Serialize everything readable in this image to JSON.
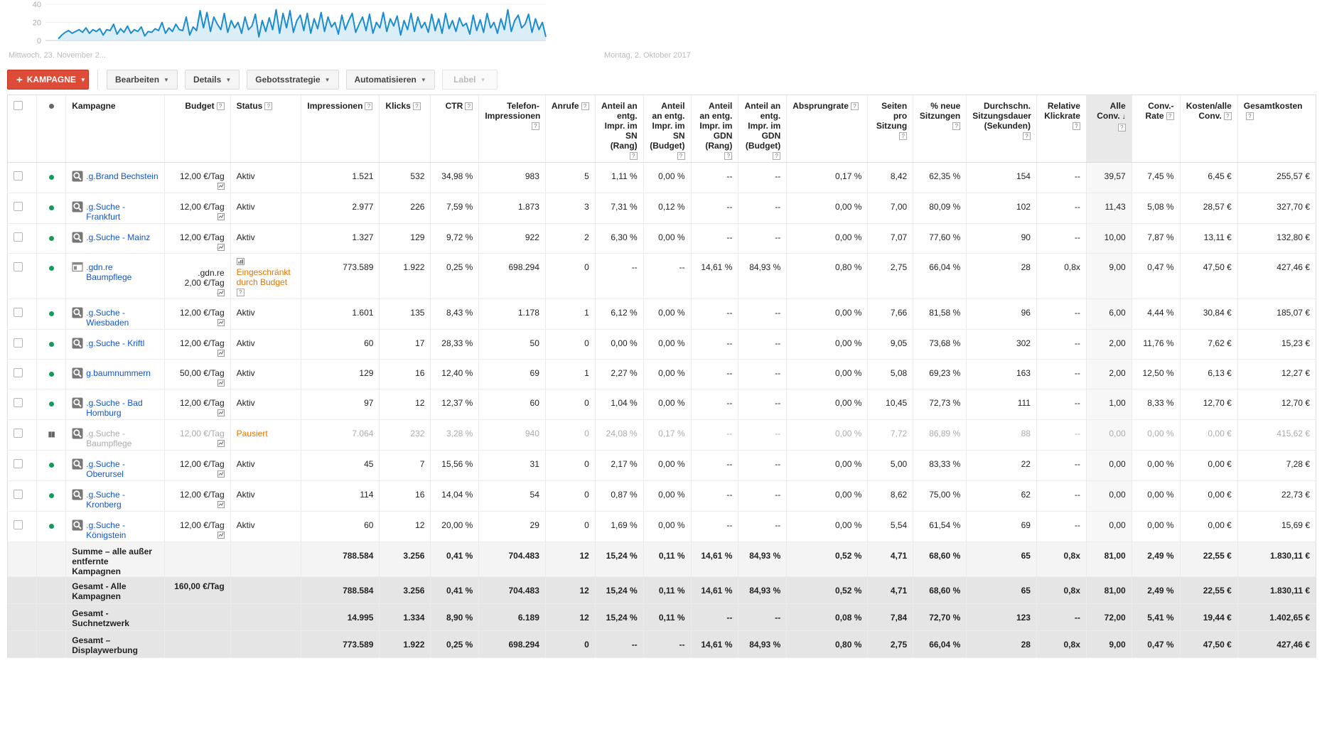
{
  "chart": {
    "y_ticks": [
      "40",
      "20",
      "0"
    ],
    "date_start": "Mittwoch, 23. November 2...",
    "date_end": "Montag, 2. Oktober 2017",
    "line_color": "#1a8ccf",
    "fill_color": "#cce7f5"
  },
  "chart_data": {
    "type": "area",
    "ylim": [
      0,
      40
    ],
    "xlabel": "",
    "ylabel": "",
    "title": "",
    "series": [
      {
        "values": [
          2,
          6,
          9,
          11,
          8,
          10,
          12,
          9,
          14,
          8,
          12,
          10,
          13,
          6,
          12,
          11,
          18,
          7,
          13,
          9,
          16,
          8,
          12,
          10,
          15,
          5,
          10,
          9,
          13,
          11,
          20,
          8,
          14,
          10,
          18,
          12,
          11,
          26,
          6,
          15,
          11,
          33,
          14,
          31,
          10,
          26,
          18,
          12,
          30,
          9,
          22,
          14,
          20,
          8,
          26,
          12,
          16,
          29,
          4,
          22,
          10,
          25,
          12,
          34,
          8,
          30,
          14,
          33,
          9,
          22,
          28,
          11,
          30,
          8,
          24,
          13,
          31,
          10,
          26,
          15,
          20,
          7,
          28,
          12,
          22,
          30,
          9,
          18,
          26,
          11,
          29,
          8,
          20,
          14,
          31,
          10,
          24,
          16,
          27,
          6,
          22,
          12,
          30,
          10,
          26,
          14,
          20,
          9,
          29,
          11,
          24,
          8,
          30,
          13,
          22,
          10,
          25,
          16,
          19,
          7,
          28,
          11,
          23,
          9,
          30,
          14,
          20,
          8,
          24,
          12,
          34,
          10,
          22,
          28,
          14,
          18,
          29,
          9,
          24,
          12,
          20,
          4
        ]
      }
    ]
  },
  "toolbar": {
    "kampagne": "KAMPAGNE",
    "bearbeiten": "Bearbeiten",
    "details": "Details",
    "gebotsstrategie": "Gebotsstrategie",
    "automatisieren": "Automatisieren",
    "label": "Label"
  },
  "headers": {
    "kampagne": "Kampagne",
    "budget": "Budget",
    "status": "Status",
    "impressionen": "Impressionen",
    "klicks": "Klicks",
    "ctr": "CTR",
    "telefon": "Telefon-Impressionen",
    "anrufe": "Anrufe",
    "sn_rang": "Anteil an entg. Impr. im SN (Rang)",
    "sn_budget": "Anteil an entg. Impr. im SN (Budget)",
    "gdn_rang": "Anteil an entg. Impr. im GDN (Rang)",
    "gdn_budget": "Anteil an entg. Impr. im GDN (Budget)",
    "absprung": "Absprungrate",
    "seiten": "Seiten pro Sitzung",
    "neue": "% neue Sitzungen",
    "dauer": "Durchschn. Sitzungsdauer (Sekunden)",
    "rel_klick": "Relative Klickrate",
    "alle_conv": "Alle Conv.",
    "conv_rate": "Conv.-Rate",
    "kosten_conv": "Kosten/alle Conv.",
    "gesamtkosten": "Gesamtkosten"
  },
  "rows": [
    {
      "name": ".g.Brand Bechstein",
      "icon": "search",
      "budget": "12,00 €/Tag",
      "budget_pre": "",
      "status": "Aktiv",
      "impr": "1.521",
      "klicks": "532",
      "ctr": "34,98 %",
      "tel": "983",
      "anrufe": "5",
      "sn_r": "1,11 %",
      "sn_b": "0,00 %",
      "gdn_r": "--",
      "gdn_b": "--",
      "abs": "0,17 %",
      "seiten": "8,42",
      "neue": "62,35 %",
      "dauer": "154",
      "rel": "--",
      "conv": "39,57",
      "crate": "7,45 %",
      "kconv": "6,45 €",
      "kosten": "255,57 €"
    },
    {
      "name": ".g.Suche - Frankfurt",
      "icon": "search",
      "budget": "12,00 €/Tag",
      "budget_pre": "",
      "status": "Aktiv",
      "impr": "2.977",
      "klicks": "226",
      "ctr": "7,59 %",
      "tel": "1.873",
      "anrufe": "3",
      "sn_r": "7,31 %",
      "sn_b": "0,12 %",
      "gdn_r": "--",
      "gdn_b": "--",
      "abs": "0,00 %",
      "seiten": "7,00",
      "neue": "80,09 %",
      "dauer": "102",
      "rel": "--",
      "conv": "11,43",
      "crate": "5,08 %",
      "kconv": "28,57 €",
      "kosten": "327,70 €"
    },
    {
      "name": ".g.Suche - Mainz",
      "icon": "search",
      "budget": "12,00 €/Tag",
      "budget_pre": "",
      "status": "Aktiv",
      "impr": "1.327",
      "klicks": "129",
      "ctr": "9,72 %",
      "tel": "922",
      "anrufe": "2",
      "sn_r": "6,30 %",
      "sn_b": "0,00 %",
      "gdn_r": "--",
      "gdn_b": "--",
      "abs": "0,00 %",
      "seiten": "7,07",
      "neue": "77,60 %",
      "dauer": "90",
      "rel": "--",
      "conv": "10,00",
      "crate": "7,87 %",
      "kconv": "13,11 €",
      "kosten": "132,80 €"
    },
    {
      "name": ".gdn.re Baumpflege",
      "icon": "display",
      "budget": "2,00 €/Tag",
      "budget_pre": ".gdn.re",
      "status": "Eingeschränkt durch Budget",
      "impr": "773.589",
      "klicks": "1.922",
      "ctr": "0,25 %",
      "tel": "698.294",
      "anrufe": "0",
      "sn_r": "--",
      "sn_b": "--",
      "gdn_r": "14,61 %",
      "gdn_b": "84,93 %",
      "abs": "0,80 %",
      "seiten": "2,75",
      "neue": "66,04 %",
      "dauer": "28",
      "rel": "0,8x",
      "conv": "9,00",
      "crate": "0,47 %",
      "kconv": "47,50 €",
      "kosten": "427,46 €"
    },
    {
      "name": ".g.Suche - Wiesbaden",
      "icon": "search",
      "budget": "12,00 €/Tag",
      "budget_pre": "",
      "status": "Aktiv",
      "impr": "1.601",
      "klicks": "135",
      "ctr": "8,43 %",
      "tel": "1.178",
      "anrufe": "1",
      "sn_r": "6,12 %",
      "sn_b": "0,00 %",
      "gdn_r": "--",
      "gdn_b": "--",
      "abs": "0,00 %",
      "seiten": "7,66",
      "neue": "81,58 %",
      "dauer": "96",
      "rel": "--",
      "conv": "6,00",
      "crate": "4,44 %",
      "kconv": "30,84 €",
      "kosten": "185,07 €"
    },
    {
      "name": ".g.Suche - Kriftl",
      "icon": "search",
      "budget": "12,00 €/Tag",
      "budget_pre": "",
      "status": "Aktiv",
      "impr": "60",
      "klicks": "17",
      "ctr": "28,33 %",
      "tel": "50",
      "anrufe": "0",
      "sn_r": "0,00 %",
      "sn_b": "0,00 %",
      "gdn_r": "--",
      "gdn_b": "--",
      "abs": "0,00 %",
      "seiten": "9,05",
      "neue": "73,68 %",
      "dauer": "302",
      "rel": "--",
      "conv": "2,00",
      "crate": "11,76 %",
      "kconv": "7,62 €",
      "kosten": "15,23 €"
    },
    {
      "name": "g.baumnummern",
      "icon": "search",
      "budget": "50,00 €/Tag",
      "budget_pre": "",
      "status": "Aktiv",
      "impr": "129",
      "klicks": "16",
      "ctr": "12,40 %",
      "tel": "69",
      "anrufe": "1",
      "sn_r": "2,27 %",
      "sn_b": "0,00 %",
      "gdn_r": "--",
      "gdn_b": "--",
      "abs": "0,00 %",
      "seiten": "5,08",
      "neue": "69,23 %",
      "dauer": "163",
      "rel": "--",
      "conv": "2,00",
      "crate": "12,50 %",
      "kconv": "6,13 €",
      "kosten": "12,27 €"
    },
    {
      "name": ".g.Suche - Bad Homburg",
      "icon": "search",
      "budget": "12,00 €/Tag",
      "budget_pre": "",
      "status": "Aktiv",
      "impr": "97",
      "klicks": "12",
      "ctr": "12,37 %",
      "tel": "60",
      "anrufe": "0",
      "sn_r": "1,04 %",
      "sn_b": "0,00 %",
      "gdn_r": "--",
      "gdn_b": "--",
      "abs": "0,00 %",
      "seiten": "10,45",
      "neue": "72,73 %",
      "dauer": "111",
      "rel": "--",
      "conv": "1,00",
      "crate": "8,33 %",
      "kconv": "12,70 €",
      "kosten": "12,70 €"
    },
    {
      "name": ".g.Suche - Baumpflege",
      "icon": "search",
      "budget": "12,00 €/Tag",
      "budget_pre": "",
      "status": "Pausiert",
      "paused": true,
      "impr": "7.064",
      "klicks": "232",
      "ctr": "3,28 %",
      "tel": "940",
      "anrufe": "0",
      "sn_r": "24,08 %",
      "sn_b": "0,17 %",
      "gdn_r": "--",
      "gdn_b": "--",
      "abs": "0,00 %",
      "seiten": "7,72",
      "neue": "86,89 %",
      "dauer": "88",
      "rel": "--",
      "conv": "0,00",
      "crate": "0,00 %",
      "kconv": "0,00 €",
      "kosten": "415,62 €"
    },
    {
      "name": ".g.Suche - Oberursel",
      "icon": "search",
      "budget": "12,00 €/Tag",
      "budget_pre": "",
      "status": "Aktiv",
      "impr": "45",
      "klicks": "7",
      "ctr": "15,56 %",
      "tel": "31",
      "anrufe": "0",
      "sn_r": "2,17 %",
      "sn_b": "0,00 %",
      "gdn_r": "--",
      "gdn_b": "--",
      "abs": "0,00 %",
      "seiten": "5,00",
      "neue": "83,33 %",
      "dauer": "22",
      "rel": "--",
      "conv": "0,00",
      "crate": "0,00 %",
      "kconv": "0,00 €",
      "kosten": "7,28 €"
    },
    {
      "name": ".g.Suche - Kronberg",
      "icon": "search",
      "budget": "12,00 €/Tag",
      "budget_pre": "",
      "status": "Aktiv",
      "impr": "114",
      "klicks": "16",
      "ctr": "14,04 %",
      "tel": "54",
      "anrufe": "0",
      "sn_r": "0,87 %",
      "sn_b": "0,00 %",
      "gdn_r": "--",
      "gdn_b": "--",
      "abs": "0,00 %",
      "seiten": "8,62",
      "neue": "75,00 %",
      "dauer": "62",
      "rel": "--",
      "conv": "0,00",
      "crate": "0,00 %",
      "kconv": "0,00 €",
      "kosten": "22,73 €"
    },
    {
      "name": ".g.Suche - Königstein",
      "icon": "search",
      "budget": "12,00 €/Tag",
      "budget_pre": "",
      "status": "Aktiv",
      "impr": "60",
      "klicks": "12",
      "ctr": "20,00 %",
      "tel": "29",
      "anrufe": "0",
      "sn_r": "1,69 %",
      "sn_b": "0,00 %",
      "gdn_r": "--",
      "gdn_b": "--",
      "abs": "0,00 %",
      "seiten": "5,54",
      "neue": "61,54 %",
      "dauer": "69",
      "rel": "--",
      "conv": "0,00",
      "crate": "0,00 %",
      "kconv": "0,00 €",
      "kosten": "15,69 €"
    }
  ],
  "totals": [
    {
      "kind": "sum",
      "name": "Summe – alle außer entfernte Kampagnen",
      "budget": "",
      "impr": "788.584",
      "klicks": "3.256",
      "ctr": "0,41 %",
      "tel": "704.483",
      "anrufe": "12",
      "sn_r": "15,24 %",
      "sn_b": "0,11 %",
      "gdn_r": "14,61 %",
      "gdn_b": "84,93 %",
      "abs": "0,52 %",
      "seiten": "4,71",
      "neue": "68,60 %",
      "dauer": "65",
      "rel": "0,8x",
      "conv": "81,00",
      "crate": "2,49 %",
      "kconv": "22,55 €",
      "kosten": "1.830,11 €"
    },
    {
      "kind": "total",
      "name": "Gesamt - Alle Kampagnen",
      "budget": "160,00 €/Tag",
      "impr": "788.584",
      "klicks": "3.256",
      "ctr": "0,41 %",
      "tel": "704.483",
      "anrufe": "12",
      "sn_r": "15,24 %",
      "sn_b": "0,11 %",
      "gdn_r": "14,61 %",
      "gdn_b": "84,93 %",
      "abs": "0,52 %",
      "seiten": "4,71",
      "neue": "68,60 %",
      "dauer": "65",
      "rel": "0,8x",
      "conv": "81,00",
      "crate": "2,49 %",
      "kconv": "22,55 €",
      "kosten": "1.830,11 €"
    },
    {
      "kind": "total",
      "name": "Gesamt - Suchnetzwerk",
      "budget": "",
      "impr": "14.995",
      "klicks": "1.334",
      "ctr": "8,90 %",
      "tel": "6.189",
      "anrufe": "12",
      "sn_r": "15,24 %",
      "sn_b": "0,11 %",
      "gdn_r": "--",
      "gdn_b": "--",
      "abs": "0,08 %",
      "seiten": "7,84",
      "neue": "72,70 %",
      "dauer": "123",
      "rel": "--",
      "conv": "72,00",
      "crate": "5,41 %",
      "kconv": "19,44 €",
      "kosten": "1.402,65 €"
    },
    {
      "kind": "total",
      "name": "Gesamt – Displaywerbung",
      "budget": "",
      "impr": "773.589",
      "klicks": "1.922",
      "ctr": "0,25 %",
      "tel": "698.294",
      "anrufe": "0",
      "sn_r": "--",
      "sn_b": "--",
      "gdn_r": "14,61 %",
      "gdn_b": "84,93 %",
      "abs": "0,80 %",
      "seiten": "2,75",
      "neue": "66,04 %",
      "dauer": "28",
      "rel": "0,8x",
      "conv": "9,00",
      "crate": "0,47 %",
      "kconv": "47,50 €",
      "kosten": "427,46 €"
    }
  ],
  "status_colors": {
    "warn": "#e37400",
    "active_dot": "#0f9d58",
    "link": "#1155cc",
    "button_red": "#dd4b39"
  },
  "icons": {
    "search": "magnifier-icon",
    "display": "display-network-icon",
    "sort": "sort-down-icon",
    "help": "help-icon"
  }
}
